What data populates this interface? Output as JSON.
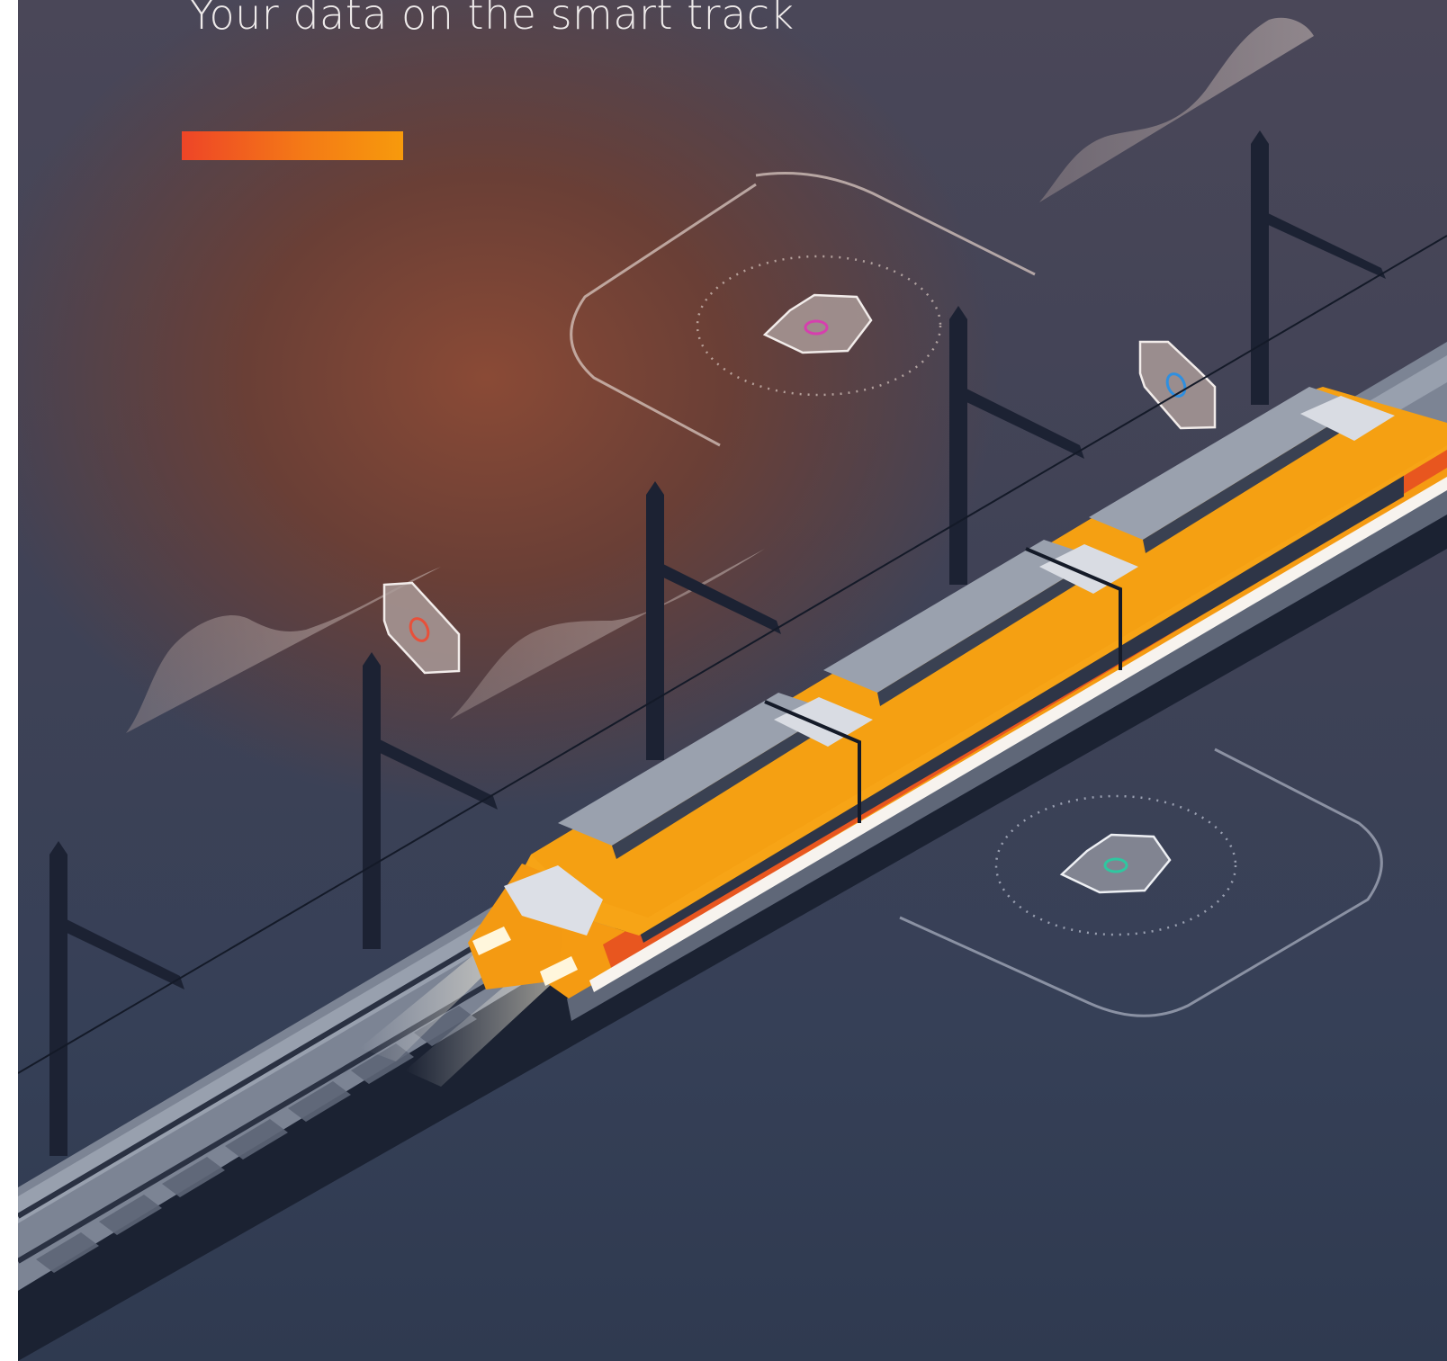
{
  "headline": "Your data on the smart track",
  "colors": {
    "accent_start": "#ee4527",
    "accent_end": "#f79a0c",
    "train_body": "#f59b12",
    "train_stripe": "#e8561f",
    "background_dark": "#2f3a50",
    "sensor_pink": "#d63fae",
    "sensor_blue": "#2f8fe0",
    "sensor_red": "#e8503a",
    "sensor_green": "#2fc7a0"
  },
  "icons": {
    "sensor_top": "hexagon-sensor-icon",
    "sensor_right": "hexagon-sensor-icon",
    "sensor_left": "hexagon-sensor-icon",
    "sensor_bottom": "hexagon-sensor-icon"
  }
}
